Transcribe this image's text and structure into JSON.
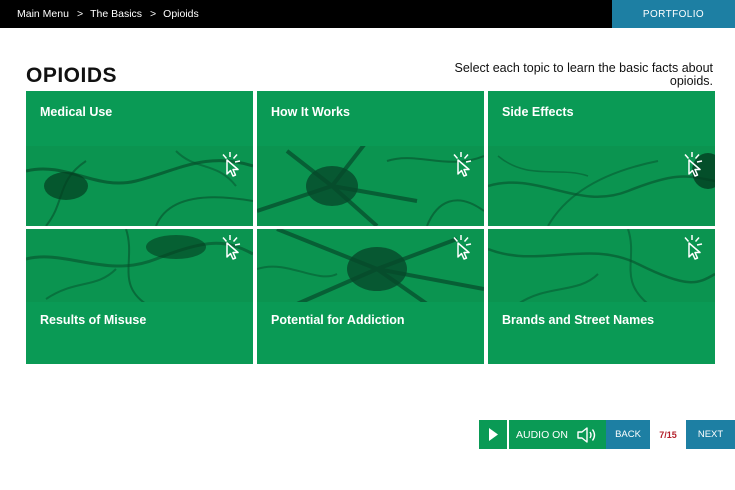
{
  "breadcrumb": {
    "items": [
      "Main Menu",
      "The Basics",
      "Opioids"
    ],
    "separator": ">"
  },
  "header": {
    "portfolio_label": "PORTFOLIO"
  },
  "page": {
    "title": "OPIOIDS",
    "instruction": "Select each topic to learn the basic facts about opioids."
  },
  "tiles": [
    {
      "label": "Medical Use",
      "icon": "click-cursor-icon"
    },
    {
      "label": "How It Works",
      "icon": "click-cursor-icon"
    },
    {
      "label": "Side Effects",
      "icon": "click-cursor-icon"
    },
    {
      "label": "Results of Misuse",
      "icon": "click-cursor-icon"
    },
    {
      "label": "Potential for Addiction",
      "icon": "click-cursor-icon"
    },
    {
      "label": "Brands and Street Names",
      "icon": "click-cursor-icon"
    }
  ],
  "controls": {
    "audio_label": "AUDIO ON",
    "back_label": "BACK",
    "page_count": "7/15",
    "next_label": "NEXT"
  },
  "colors": {
    "tile_green": "#0a9a55",
    "nav_blue": "#1d7fa3",
    "topbar": "#000000",
    "page_count": "#b3202b"
  }
}
